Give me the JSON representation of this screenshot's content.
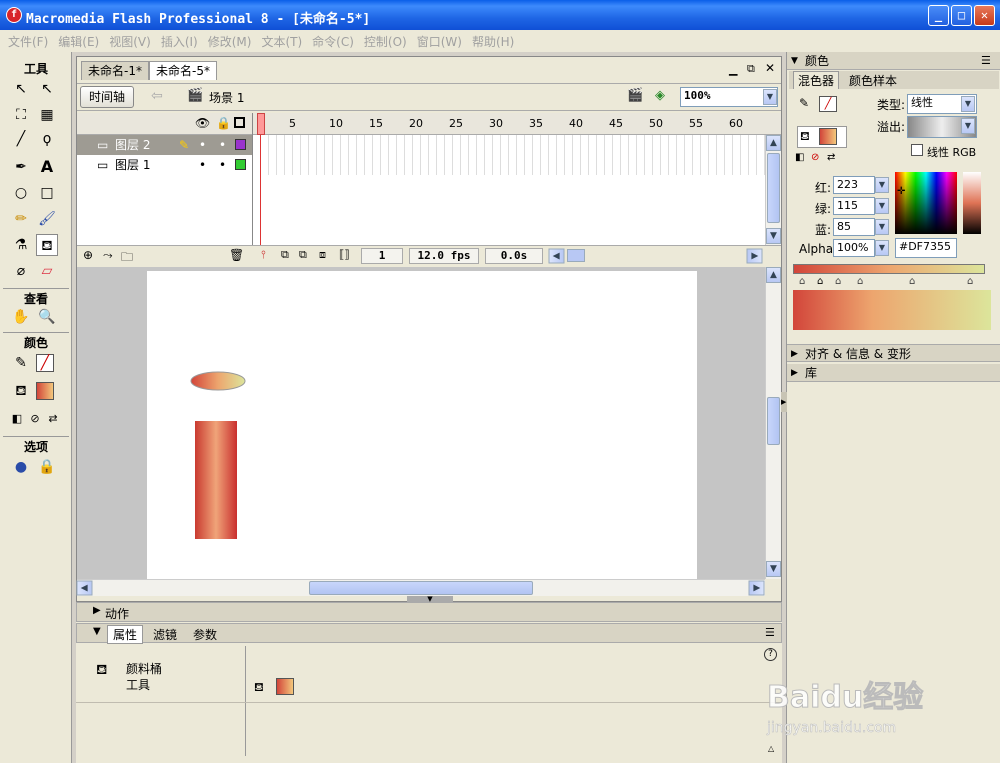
{
  "window": {
    "title": "Macromedia Flash Professional 8 - [未命名-5*]",
    "logo_glyph": "f",
    "min": "_",
    "max": "□",
    "close": "✕"
  },
  "menu": [
    "文件(F)",
    "编辑(E)",
    "视图(V)",
    "插入(I)",
    "修改(M)",
    "文本(T)",
    "命令(C)",
    "控制(O)",
    "窗口(W)",
    "帮助(H)"
  ],
  "tools": {
    "title": "工具",
    "view": "查看",
    "colors": "颜色",
    "options": "选项",
    "text_tool": "A"
  },
  "document": {
    "tabs": [
      "未命名-1*",
      "未命名-5*"
    ],
    "timeline_button": "时间轴",
    "scene": "场景 1",
    "zoom": "100%",
    "layers": [
      {
        "name": "图层 2",
        "color": "#9933cc"
      },
      {
        "name": "图层 1",
        "color": "#33cc33"
      }
    ],
    "ruler": [
      "1",
      "5",
      "10",
      "15",
      "20",
      "25",
      "30",
      "35",
      "40",
      "45",
      "50",
      "55",
      "60"
    ],
    "current_frame": "1",
    "fps": "12.0 fps",
    "time": "0.0s"
  },
  "panels": {
    "actions": "动作",
    "props_tabs": [
      "属性",
      "滤镜",
      "参数"
    ],
    "tool_name": "颜料桶",
    "tool_sub": "工具"
  },
  "color_panel": {
    "title": "颜色",
    "tabs": [
      "混色器",
      "颜色样本"
    ],
    "type_label": "类型:",
    "type_value": "线性",
    "overflow_label": "溢出:",
    "linear_rgb": "线性 RGB",
    "red_label": "红:",
    "red": "223",
    "green_label": "绿:",
    "green": "115",
    "blue_label": "蓝:",
    "blue": "85",
    "alpha_label": "Alpha:",
    "alpha": "100%",
    "hex": "#DF7355",
    "fill_color": "#DF7355"
  },
  "collapsed_panels": [
    "对齐 & 信息 & 变形",
    "库"
  ],
  "watermark": {
    "text": "Baidu经验",
    "url": "jingyan.baidu.com"
  }
}
